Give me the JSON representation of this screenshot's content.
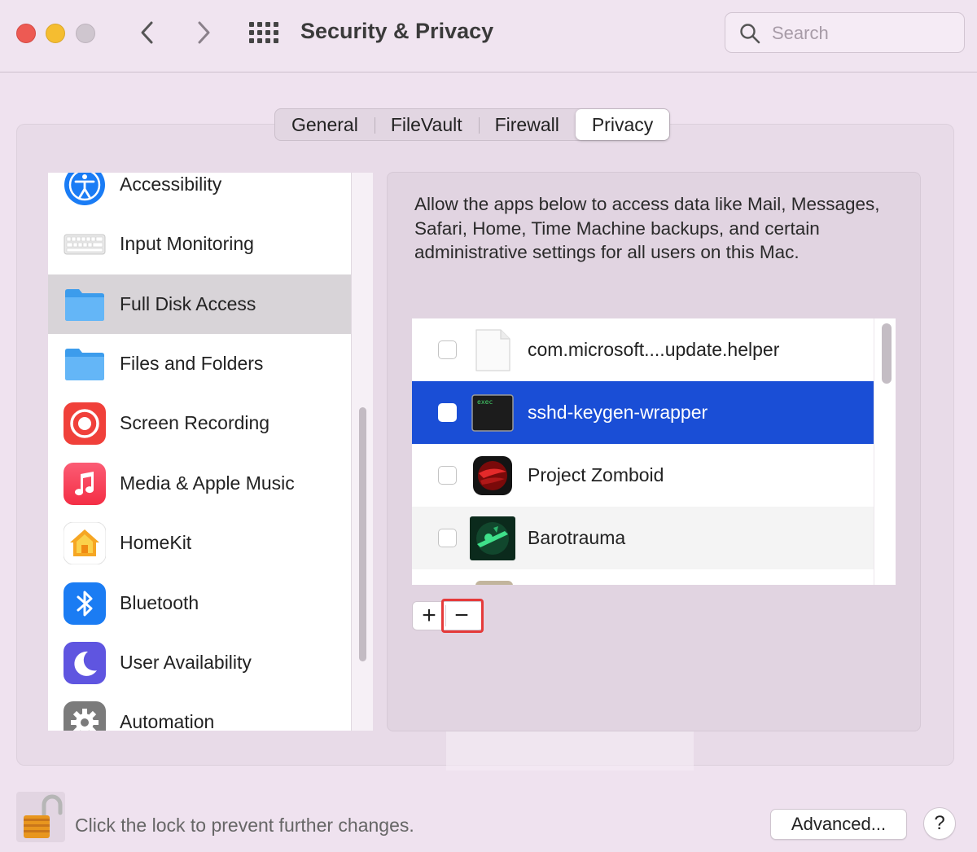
{
  "window": {
    "title": "Security & Privacy"
  },
  "search": {
    "placeholder": "Search"
  },
  "tabs": [
    {
      "label": "General"
    },
    {
      "label": "FileVault"
    },
    {
      "label": "Firewall"
    },
    {
      "label": "Privacy",
      "active": true
    }
  ],
  "sidebar": {
    "items": [
      {
        "label": "Accessibility",
        "icon": "accessibility-icon"
      },
      {
        "label": "Input Monitoring",
        "icon": "keyboard-icon"
      },
      {
        "label": "Full Disk Access",
        "icon": "folder-icon",
        "selected": true
      },
      {
        "label": "Files and Folders",
        "icon": "folder-icon"
      },
      {
        "label": "Screen Recording",
        "icon": "screen-recording-icon"
      },
      {
        "label": "Media & Apple Music",
        "icon": "music-note-icon"
      },
      {
        "label": "HomeKit",
        "icon": "home-icon"
      },
      {
        "label": "Bluetooth",
        "icon": "bluetooth-icon"
      },
      {
        "label": "User Availability",
        "icon": "moon-icon"
      },
      {
        "label": "Automation",
        "icon": "gear-icon"
      }
    ]
  },
  "main": {
    "description": "Allow the apps below to access data like Mail, Messages, Safari, Home, Time Machine backups, and certain administrative settings for all users on this Mac.",
    "apps": [
      {
        "label": "com.microsoft....update.helper",
        "checked": false,
        "icon": "document-icon"
      },
      {
        "label": "sshd-keygen-wrapper",
        "checked": false,
        "selected": true,
        "icon": "terminal-exec-icon",
        "icon_text": "exec"
      },
      {
        "label": "Project Zomboid",
        "checked": false,
        "icon": "project-zomboid-icon"
      },
      {
        "label": "Barotrauma",
        "checked": false,
        "icon": "barotrauma-icon"
      }
    ],
    "add_label": "+",
    "remove_label": "−"
  },
  "footer": {
    "lock_text": "Click the lock to prevent further changes.",
    "advanced_label": "Advanced...",
    "help_label": "?"
  },
  "colors": {
    "selection": "#1a4ed6",
    "highlight_box": "#e53a3a",
    "close": "#ed5a53",
    "minimize": "#f5bd30"
  }
}
